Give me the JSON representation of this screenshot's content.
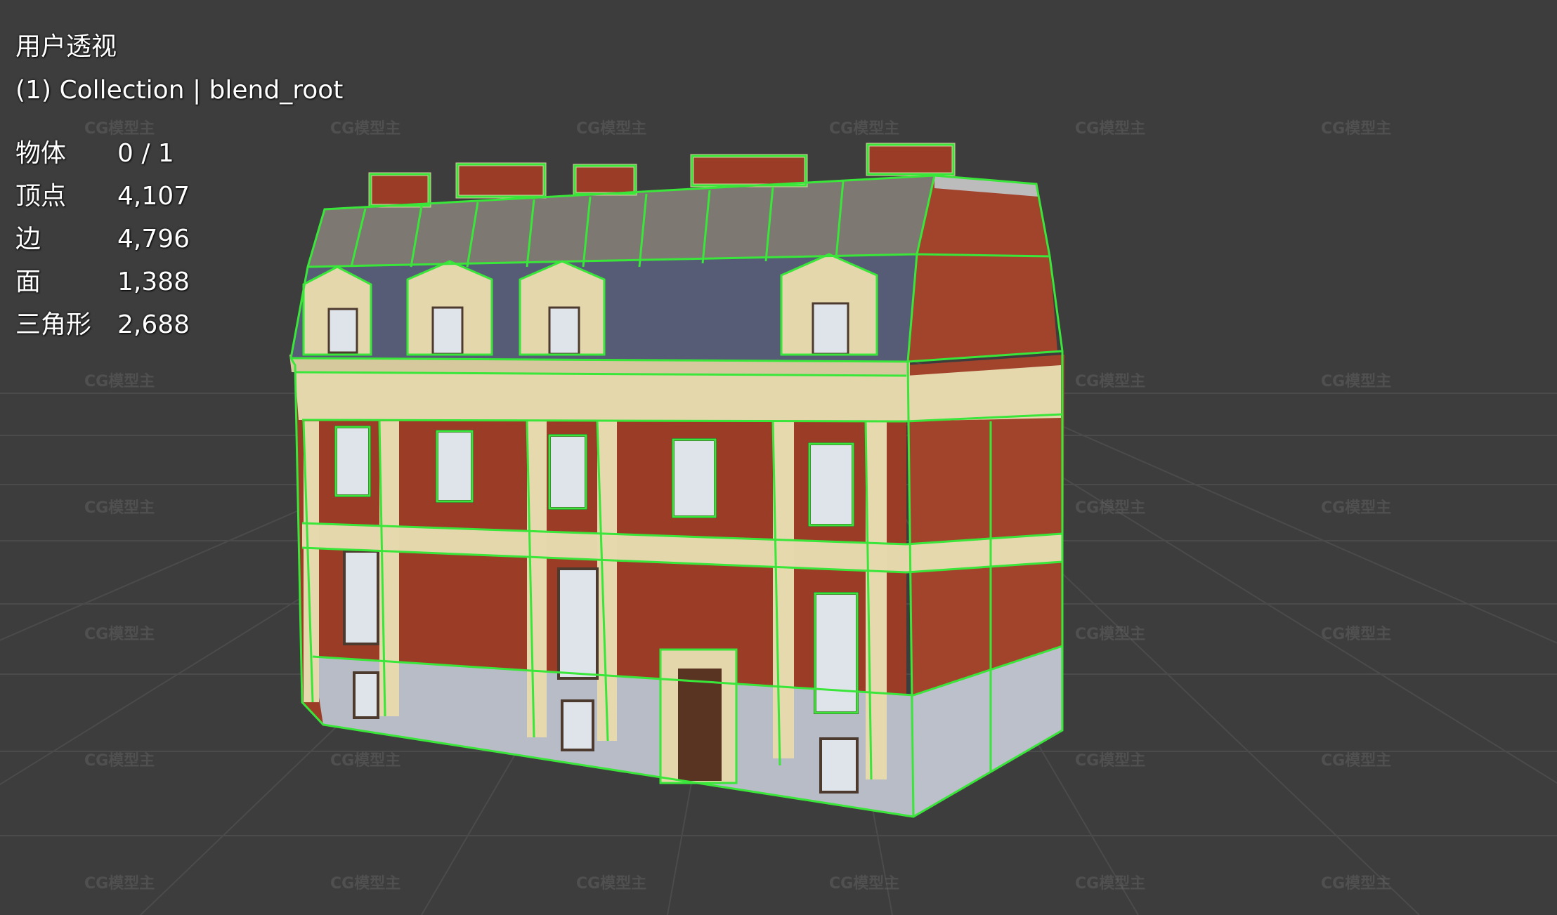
{
  "viewport": {
    "view_name": "用户透视",
    "collection_line": "(1) Collection | blend_root"
  },
  "stats": [
    {
      "label": "物体",
      "value": "0 / 1"
    },
    {
      "label": "顶点",
      "value": "4,107"
    },
    {
      "label": "边",
      "value": "4,796"
    },
    {
      "label": "面",
      "value": "1,388"
    },
    {
      "label": "三角形",
      "value": "2,688"
    }
  ],
  "watermark": "CG模型主",
  "colors": {
    "background": "#3d3d3d",
    "grid": "#4a4a4a",
    "selection_outline": "#39e639",
    "brick": "#9b3c26",
    "stone": "#e4d7ac",
    "roof_slate": "#5a6078",
    "roof_tile": "#7e7872"
  }
}
